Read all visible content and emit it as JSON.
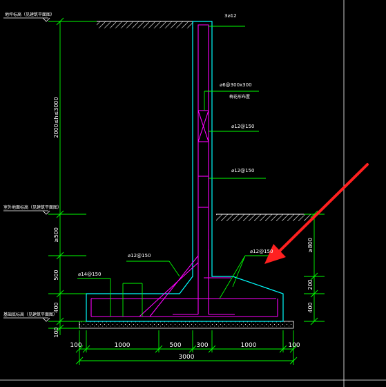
{
  "labels": {
    "top_elev": "地坪标高（见建筑平面图）",
    "mid_elev": "室外地面标高（见建筑平面图）",
    "bottom_elev": "基础底标高（见建筑平面图）",
    "top_bars": "3⌀12",
    "tie_bars": "⌀6@300x300",
    "tie_note": "梅花形布置",
    "wall_vert_1": "⌀12@150",
    "wall_vert_2": "⌀12@150",
    "heel_bars": "⌀12@150",
    "toe_bars": "⌀12@150",
    "base_bars": "⌀14@150"
  },
  "dims_left": {
    "h_total": "2000≤h≤3000",
    "h_500": "≥500",
    "h_500b": "500",
    "h_400": "400",
    "h_100": "100"
  },
  "dims_right": {
    "r_800": "≥800",
    "r_200": "200",
    "r_400": "400"
  },
  "dims_bottom": {
    "b1": "100",
    "b2": "1000",
    "b3": "500",
    "b4": "300",
    "b5": "1000",
    "b6": "100",
    "total": "3000"
  },
  "colors": {
    "background": "#000000",
    "outline": "#00ffff",
    "rebar": "#ff00ff",
    "dimension": "#00ff00",
    "leader": "#00ff00",
    "hatch": "#ffffff",
    "arrow": "#ff2020"
  }
}
